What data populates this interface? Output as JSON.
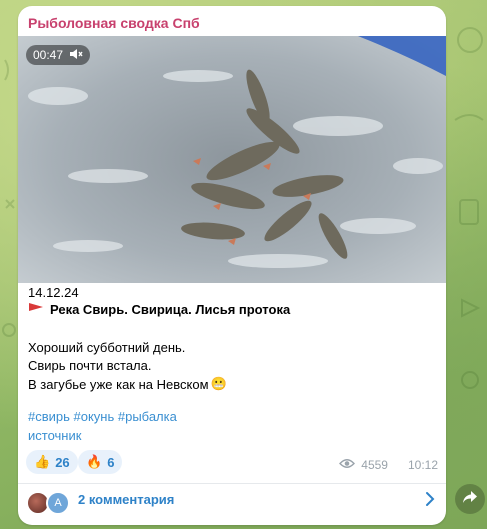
{
  "channel": {
    "name": "Рыболовная сводка Спб"
  },
  "video": {
    "duration": "00:47"
  },
  "post": {
    "date": "14.12.24",
    "place": "Река Свирь. Свирица. Лисья протока",
    "line1": "Хороший субботний день.",
    "line2": "Свирь почти встала.",
    "line3": "В загубье уже как на Невском",
    "emoji": "😬",
    "tags": "#свирь #окунь #рыбалка",
    "source": "источник"
  },
  "reactions": [
    {
      "emoji": "👍",
      "count": "26"
    },
    {
      "emoji": "🔥",
      "count": "6"
    }
  ],
  "meta": {
    "views": "4559",
    "time": "10:12"
  },
  "comments": {
    "avatar_letter": "A",
    "label": "2 комментария"
  },
  "colors": {
    "channel": "#c8416e",
    "link": "#2e82c8",
    "accent_flag": "#d93a3a"
  }
}
